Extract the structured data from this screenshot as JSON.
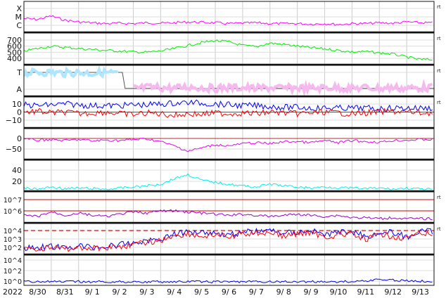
{
  "chart_data": {
    "type": "line",
    "year_label": "2022",
    "x_tick_labels": [
      "8/30",
      "8/31",
      "9/ 1",
      "9/ 2",
      "9/ 3",
      "9/ 4",
      "9/ 5",
      "9/ 6",
      "9/ 7",
      "9/ 8",
      "9/ 9",
      "9/10",
      "9/11",
      "9/12",
      "9/13"
    ],
    "x_units": "days since 8/30 00:00, sampled every 0.5 day",
    "right_label": "rt",
    "panels": [
      {
        "name": "xray-flux",
        "scale": "log",
        "ticks": [
          {
            "v": -6,
            "label": "C"
          },
          {
            "v": -5,
            "label": "M"
          },
          {
            "v": -4,
            "label": "X"
          }
        ],
        "rt": true,
        "series": [
          {
            "name": "xray",
            "color": "#ff00ff",
            "values": [
              -5.2,
              -5.3,
              -4.9,
              -5.4,
              -5.6,
              -5.7,
              -5.8,
              -5.75,
              -5.8,
              -5.7,
              -5.75,
              -5.7,
              -5.6,
              -5.65,
              -5.7,
              -5.8,
              -5.75,
              -5.7,
              -5.8,
              -5.8,
              -5.8,
              -5.85,
              -5.8,
              -5.9,
              -5.8,
              -5.8,
              -5.7,
              -5.75,
              -5.6,
              -5.7
            ]
          }
        ]
      },
      {
        "name": "solar-wind-speed",
        "ticks": [
          {
            "v": 700,
            "label": "700"
          },
          {
            "v": 600,
            "label": "600"
          },
          {
            "v": 500,
            "label": "500"
          },
          {
            "v": 400,
            "label": "400"
          }
        ],
        "rt": true,
        "series": [
          {
            "name": "speed",
            "color": "#00ee00",
            "values": [
              520,
              560,
              600,
              580,
              560,
              545,
              530,
              520,
              505,
              500,
              520,
              560,
              610,
              660,
              690,
              670,
              610,
              590,
              650,
              630,
              600,
              575,
              555,
              530,
              505,
              510,
              490,
              470,
              420,
              380
            ]
          }
        ]
      },
      {
        "name": "imf-sector",
        "ticks": [
          {
            "v": 1,
            "label": "T"
          },
          {
            "v": 0,
            "label": "A"
          }
        ],
        "rt": true,
        "series": [
          {
            "name": "T",
            "color": "#aee6ff",
            "values": [
              0.95,
              1,
              1,
              0.95,
              1,
              0.95,
              1,
              0.9,
              null,
              null,
              null,
              null,
              null,
              null,
              null,
              null,
              null,
              null,
              null,
              null,
              null,
              null,
              null,
              null,
              null,
              null,
              null,
              null,
              null,
              null
            ]
          },
          {
            "name": "A",
            "color": "#f7b8f0",
            "values": [
              null,
              null,
              null,
              null,
              null,
              null,
              null,
              null,
              0.05,
              0.1,
              0.1,
              0.05,
              0.15,
              0.1,
              0.05,
              0.1,
              0.1,
              0.05,
              0.1,
              0.05,
              0.1,
              0.05,
              0.1,
              0.1,
              0.05,
              0.1,
              0.05,
              0.1,
              0.05,
              0.1
            ]
          }
        ]
      },
      {
        "name": "imf-bt-bz",
        "ticks": [
          {
            "v": 10,
            "label": "10"
          },
          {
            "v": 0,
            "label": "0"
          },
          {
            "v": -10,
            "label": "−10"
          }
        ],
        "rt": true,
        "zero_line": 0,
        "series": [
          {
            "name": "Bt",
            "color": "#0000ff",
            "values": [
              9,
              8,
              9,
              10,
              9,
              8,
              8,
              8,
              9,
              9,
              10,
              11,
              12,
              11,
              10,
              9,
              8,
              8,
              7,
              6,
              6,
              5,
              5,
              5,
              5,
              5,
              4,
              5,
              5,
              5
            ]
          },
          {
            "name": "Bz",
            "color": "#ff0000",
            "values": [
              0,
              1,
              -1,
              0,
              -2,
              -1,
              0,
              -2,
              -3,
              -1,
              -2,
              -4,
              -2,
              -3,
              -1,
              -2,
              -1,
              -2,
              0,
              -1,
              -2,
              -1,
              0,
              -1,
              -2,
              -1,
              0,
              1,
              0,
              -1
            ]
          }
        ]
      },
      {
        "name": "dst",
        "ticks": [
          {
            "v": 0,
            "label": "0"
          },
          {
            "v": -50,
            "label": "−50"
          }
        ],
        "rt": false,
        "zero_line": 0,
        "series": [
          {
            "name": "Dst",
            "color": "#ee00ee",
            "values": [
              -3,
              -8,
              -5,
              -10,
              -5,
              -12,
              -8,
              -10,
              -5,
              -2,
              -15,
              -35,
              -60,
              -45,
              -30,
              -35,
              -25,
              -20,
              -25,
              -15,
              -15,
              -20,
              -10,
              -20,
              -10,
              -15,
              -18,
              -10,
              -8,
              -5
            ]
          }
        ]
      },
      {
        "name": "kp-index",
        "ticks": [
          {
            "v": 40,
            "label": "40"
          },
          {
            "v": 20,
            "label": "20"
          }
        ],
        "rt": false,
        "series": [
          {
            "name": "kp",
            "color": "#00eeee",
            "values": [
              8,
              6,
              10,
              7,
              8,
              7,
              6,
              8,
              10,
              12,
              15,
              25,
              32,
              22,
              18,
              15,
              12,
              10,
              15,
              12,
              10,
              8,
              10,
              9,
              8,
              7,
              8,
              6,
              8,
              6
            ]
          }
        ]
      },
      {
        "name": "electron-flux",
        "scale": "log",
        "ticks": [
          {
            "v": 7,
            "label": "10^7"
          },
          {
            "v": 6,
            "label": "10^6"
          }
        ],
        "rt": true,
        "ref_lines": [
          7,
          6
        ],
        "series": [
          {
            "name": "electrons",
            "color": "#9900cc",
            "values": [
              5.6,
              5.5,
              5.9,
              5.6,
              5.8,
              5.6,
              5.5,
              5.7,
              5.9,
              5.8,
              6.0,
              6.0,
              5.9,
              5.8,
              5.7,
              5.6,
              5.7,
              5.6,
              5.5,
              5.6,
              5.7,
              5.6,
              5.5,
              5.6,
              5.4,
              5.4,
              5.3,
              5.4,
              5.3,
              5.3
            ]
          }
        ]
      },
      {
        "name": "proton-flux",
        "scale": "log",
        "ticks": [
          {
            "v": 4,
            "label": "10^4"
          },
          {
            "v": 3,
            "label": "10^3"
          },
          {
            "v": 2,
            "label": "10^2"
          }
        ],
        "rt": true,
        "dashed_line": 4,
        "series": [
          {
            "name": "blue",
            "color": "#0000ff",
            "values": [
              1.9,
              2.0,
              2.1,
              1.9,
              2.2,
              2.0,
              2.1,
              2.3,
              2.5,
              2.8,
              3.0,
              3.6,
              3.8,
              3.9,
              3.7,
              3.5,
              3.8,
              3.9,
              4.0,
              3.7,
              3.8,
              4.0,
              3.5,
              3.8,
              3.9,
              3.3,
              3.7,
              3.8,
              3.2,
              3.9
            ]
          },
          {
            "name": "red",
            "color": "#ff0000",
            "values": [
              1.8,
              1.9,
              2.0,
              1.8,
              2.0,
              1.9,
              2.0,
              2.1,
              2.3,
              2.6,
              2.8,
              3.4,
              3.6,
              3.3,
              3.5,
              3.2,
              3.6,
              3.7,
              3.8,
              3.3,
              3.6,
              3.8,
              3.2,
              3.5,
              3.6,
              2.9,
              3.5,
              3.3,
              3.1,
              3.6
            ]
          }
        ]
      },
      {
        "name": "high-energy-flux",
        "scale": "log",
        "ticks": [
          {
            "v": 4,
            "label": "10^4"
          },
          {
            "v": 2,
            "label": "10^2"
          },
          {
            "v": 0,
            "label": "10^0"
          }
        ],
        "rt": false,
        "series": [
          {
            "name": "flux",
            "color": "#0000ee",
            "values": [
              0,
              -0.1,
              -0.1,
              -0.15,
              -0.1,
              -0.15,
              -0.1,
              -0.15,
              -0.1,
              -0.15,
              -0.1,
              -0.15,
              -0.1,
              -0.1,
              -0.15,
              -0.1,
              -0.1,
              -0.15,
              -0.1,
              -0.1,
              -0.15,
              -0.1,
              -0.1,
              -0.1,
              -0.1,
              0.1,
              0.3,
              0.2,
              0.1,
              0
            ]
          }
        ]
      }
    ]
  }
}
